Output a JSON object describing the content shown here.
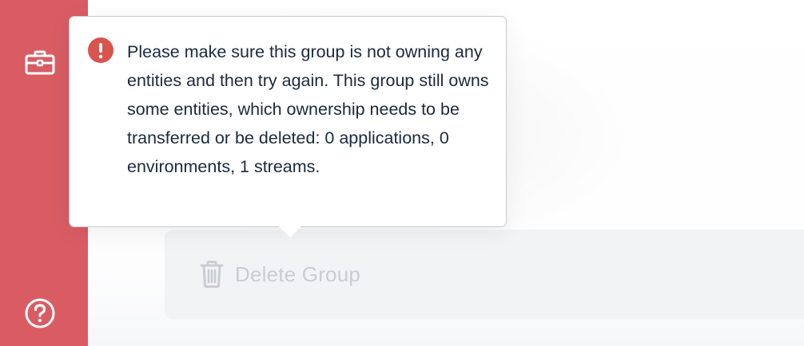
{
  "tooltip": {
    "icon": "error-circle-icon",
    "message": "Please make sure this group is not owning any entities and then try again. This group still owns some entities, which ownership needs to be transferred or be deleted: 0 applications, 0 environments, 1 streams.",
    "icon_color": "#d9534f"
  },
  "sidebar": {
    "background_color": "#d95c63",
    "items": [
      {
        "icon": "briefcase-icon"
      },
      {
        "icon": "help-circle-icon"
      }
    ]
  },
  "delete_panel": {
    "button_label": "Delete Group",
    "button_icon": "trash-icon",
    "disabled": true,
    "label_color": "#c9cdd3"
  }
}
